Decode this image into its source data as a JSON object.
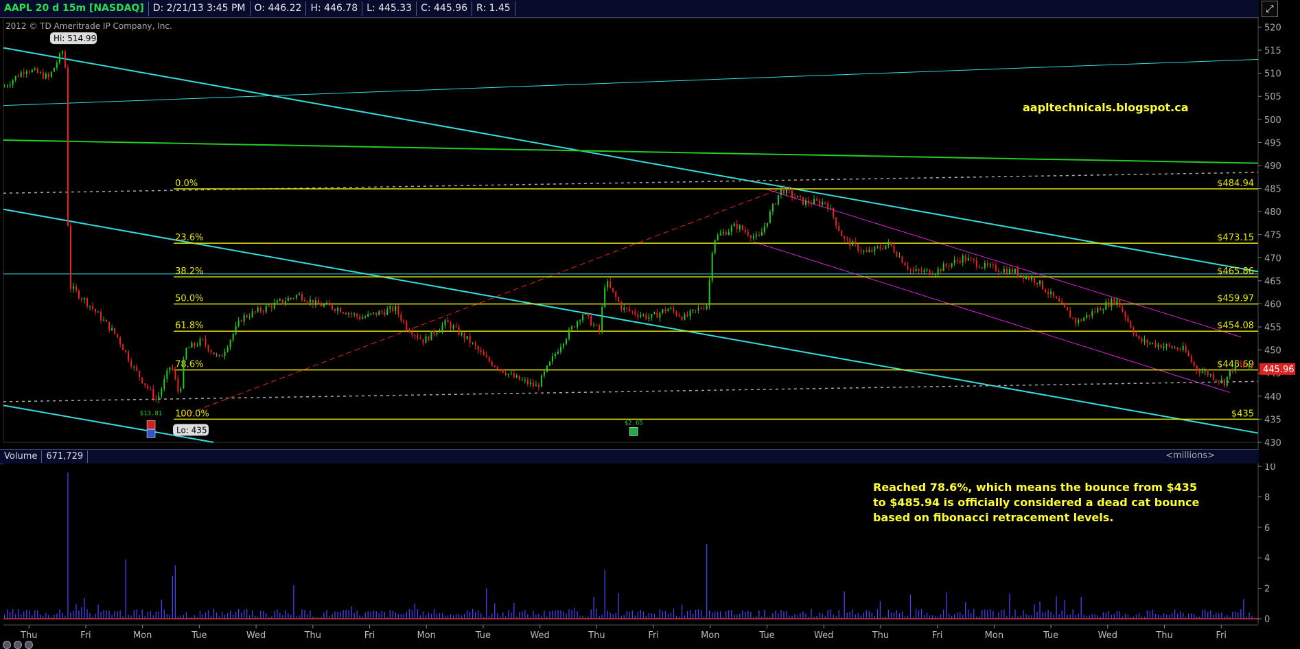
{
  "header": {
    "symbol": "AAPL 20 d 15m [NASDAQ]",
    "date": "D: 2/21/13 3:45 PM",
    "open": "O: 446.22",
    "high": "H: 446.78",
    "low": "L: 445.33",
    "close": "C: 445.96",
    "range": "R: 1.45"
  },
  "copyright": "2012 © TD Ameritrade IP Company, Inc.",
  "watermark": "aapltechnicals.blogspot.ca",
  "hi_label": "Hi: 514.99",
  "lo_label": "Lo: 435",
  "last_price": "445.96",
  "volume_header": {
    "label": "Volume",
    "value": "671,729",
    "unit": "<millions>"
  },
  "annotation": {
    "lines": [
      "Reached 78.6%, which means the bounce from $435",
      "to $485.94 is officially considered a dead cat bounce",
      "based on fibonacci retracement levels."
    ]
  },
  "events": [
    {
      "label": "$13.81",
      "x": 2.6
    },
    {
      "label": "$2.65",
      "x": 11.1
    }
  ],
  "colors": {
    "up": "#22cc22",
    "down": "#ee2222",
    "fib": "#e6e600",
    "trend": "#33dddd",
    "channel": "#dd22dd",
    "green_line": "#22cc22",
    "volume": "#4444ff",
    "price_badge": "#dd2222",
    "watermark": "#ffff33"
  },
  "chart_data": {
    "type": "candlestick",
    "ylim": [
      430,
      522
    ],
    "y_ticks": [
      430,
      435,
      440,
      445,
      450,
      455,
      460,
      465,
      470,
      475,
      480,
      485,
      490,
      495,
      500,
      505,
      510,
      515,
      520
    ],
    "x_range": [
      0,
      20
    ],
    "x_ticks": [
      {
        "label": "Thu",
        "x": 1
      },
      {
        "label": "Fri",
        "x": 2
      },
      {
        "label": "Mon",
        "x": 3
      },
      {
        "label": "Tue",
        "x": 4
      },
      {
        "label": "Wed",
        "x": 5
      },
      {
        "label": "Thu",
        "x": 6
      },
      {
        "label": "Fri",
        "x": 7
      },
      {
        "label": "Mon",
        "x": 8
      },
      {
        "label": "Tue",
        "x": 9
      },
      {
        "label": "Wed",
        "x": 10
      },
      {
        "label": "Thu",
        "x": 11
      },
      {
        "label": "Fri",
        "x": 12
      },
      {
        "label": "Mon",
        "x": 13
      },
      {
        "label": "Tue",
        "x": 14
      },
      {
        "label": "Wed",
        "x": 15
      },
      {
        "label": "Thu",
        "x": 16
      },
      {
        "label": "Fri",
        "x": 17
      },
      {
        "label": "Mon",
        "x": 18
      },
      {
        "label": "Tue",
        "x": 19
      },
      {
        "label": "Wed",
        "x": 20
      },
      {
        "label": "Thu",
        "x": 21
      },
      {
        "label": "Fri",
        "x": 22
      }
    ],
    "fibonacci": [
      {
        "label": "0.0%",
        "price": 484.94,
        "price_label": "$484.94"
      },
      {
        "label": "23.6%",
        "price": 473.15,
        "price_label": "$473.15"
      },
      {
        "label": "38.2%",
        "price": 465.86,
        "price_label": "$465.86"
      },
      {
        "label": "50.0%",
        "price": 459.97,
        "price_label": "$459.97"
      },
      {
        "label": "61.8%",
        "price": 454.08,
        "price_label": "$454.08"
      },
      {
        "label": "78.6%",
        "price": 445.69,
        "price_label": "$445.69"
      },
      {
        "label": "100.0%",
        "price": 435,
        "price_label": "$435"
      }
    ],
    "fib_x_start": 3,
    "lines": [
      {
        "name": "trend-down-upper",
        "kind": "trend",
        "points": [
          [
            0,
            515.5
          ],
          [
            22.1,
            467
          ]
        ]
      },
      {
        "name": "trend-down-lower",
        "kind": "trend",
        "points": [
          [
            0,
            480.5
          ],
          [
            22.1,
            432
          ]
        ]
      },
      {
        "name": "trend-bottom",
        "kind": "trend",
        "points": [
          [
            0,
            438
          ],
          [
            3.7,
            430
          ]
        ]
      },
      {
        "name": "trend-up-thin",
        "kind": "trend_thin",
        "points": [
          [
            0,
            503
          ],
          [
            22.1,
            513
          ]
        ]
      },
      {
        "name": "support-green",
        "kind": "green",
        "points": [
          [
            0,
            495.5
          ],
          [
            22.1,
            490.5
          ]
        ]
      },
      {
        "name": "horizontal-465",
        "kind": "thin_h",
        "points": [
          [
            0,
            466.5
          ],
          [
            22.1,
            466.5
          ]
        ]
      },
      {
        "name": "channel-top",
        "kind": "channel",
        "points": [
          [
            13.4,
            485
          ],
          [
            21.8,
            452.8
          ]
        ]
      },
      {
        "name": "channel-bottom",
        "kind": "channel",
        "points": [
          [
            13.2,
            473.5
          ],
          [
            21.6,
            440.8
          ]
        ]
      },
      {
        "name": "fib-anchor",
        "kind": "dashed_red",
        "points": [
          [
            3.1,
            435.5
          ],
          [
            13.7,
            485
          ]
        ]
      },
      {
        "name": "dotted-upper",
        "kind": "dotted",
        "points": [
          [
            0,
            484
          ],
          [
            22.1,
            488.5
          ]
        ]
      },
      {
        "name": "dotted-lower",
        "kind": "dotted",
        "points": [
          [
            0,
            438.8
          ],
          [
            22.1,
            443.2
          ]
        ]
      }
    ],
    "path_anchors": [
      [
        0,
        507
      ],
      [
        0.4,
        511
      ],
      [
        0.8,
        509
      ],
      [
        1.05,
        515
      ],
      [
        1.1,
        510
      ],
      [
        1.15,
        464
      ],
      [
        1.5,
        460
      ],
      [
        2.0,
        453
      ],
      [
        2.3,
        446
      ],
      [
        2.7,
        439
      ],
      [
        2.95,
        447
      ],
      [
        3.1,
        440
      ],
      [
        3.2,
        450
      ],
      [
        3.5,
        452
      ],
      [
        3.8,
        448
      ],
      [
        4.2,
        457
      ],
      [
        4.6,
        459
      ],
      [
        5.2,
        462
      ],
      [
        5.5,
        460
      ],
      [
        5.9,
        459
      ],
      [
        6.3,
        457
      ],
      [
        6.9,
        459
      ],
      [
        7.1,
        455
      ],
      [
        7.4,
        452
      ],
      [
        7.8,
        456
      ],
      [
        8.2,
        452
      ],
      [
        8.5,
        448
      ],
      [
        9.0,
        444
      ],
      [
        9.4,
        442
      ],
      [
        9.8,
        451
      ],
      [
        10.2,
        458
      ],
      [
        10.5,
        454
      ],
      [
        10.6,
        465
      ],
      [
        10.9,
        459
      ],
      [
        11.4,
        457
      ],
      [
        11.7,
        459
      ],
      [
        12.0,
        457
      ],
      [
        12.4,
        460
      ],
      [
        12.5,
        474
      ],
      [
        12.9,
        477
      ],
      [
        13.3,
        474
      ],
      [
        13.7,
        485
      ],
      [
        14.1,
        482
      ],
      [
        14.5,
        482
      ],
      [
        14.8,
        474
      ],
      [
        15.2,
        471
      ],
      [
        15.6,
        473
      ],
      [
        16.0,
        467
      ],
      [
        16.4,
        467
      ],
      [
        16.9,
        470
      ],
      [
        17.3,
        468
      ],
      [
        17.8,
        467
      ],
      [
        18.2,
        465
      ],
      [
        18.6,
        460
      ],
      [
        18.9,
        456
      ],
      [
        19.3,
        459
      ],
      [
        19.6,
        461
      ],
      [
        20.0,
        452
      ],
      [
        20.4,
        451
      ],
      [
        20.8,
        450
      ],
      [
        21.0,
        446
      ],
      [
        21.2,
        445
      ],
      [
        21.5,
        443
      ],
      [
        21.7,
        447
      ],
      [
        22.0,
        446
      ]
    ],
    "volume": {
      "ylim": [
        0,
        10
      ],
      "y_ticks": [
        0,
        2,
        4,
        6,
        8,
        10
      ],
      "spikes": [
        {
          "x": 1.12,
          "value": 9.6
        },
        {
          "x": 2.15,
          "value": 3.9
        },
        {
          "x": 3.05,
          "value": 3.5
        },
        {
          "x": 3.0,
          "value": 2.8
        },
        {
          "x": 10.6,
          "value": 3.2
        },
        {
          "x": 12.4,
          "value": 4.9
        },
        {
          "x": 5.1,
          "value": 2.2
        },
        {
          "x": 8.5,
          "value": 2.0
        },
        {
          "x": 14.8,
          "value": 1.8
        },
        {
          "x": 16.0,
          "value": 1.6
        }
      ]
    }
  }
}
